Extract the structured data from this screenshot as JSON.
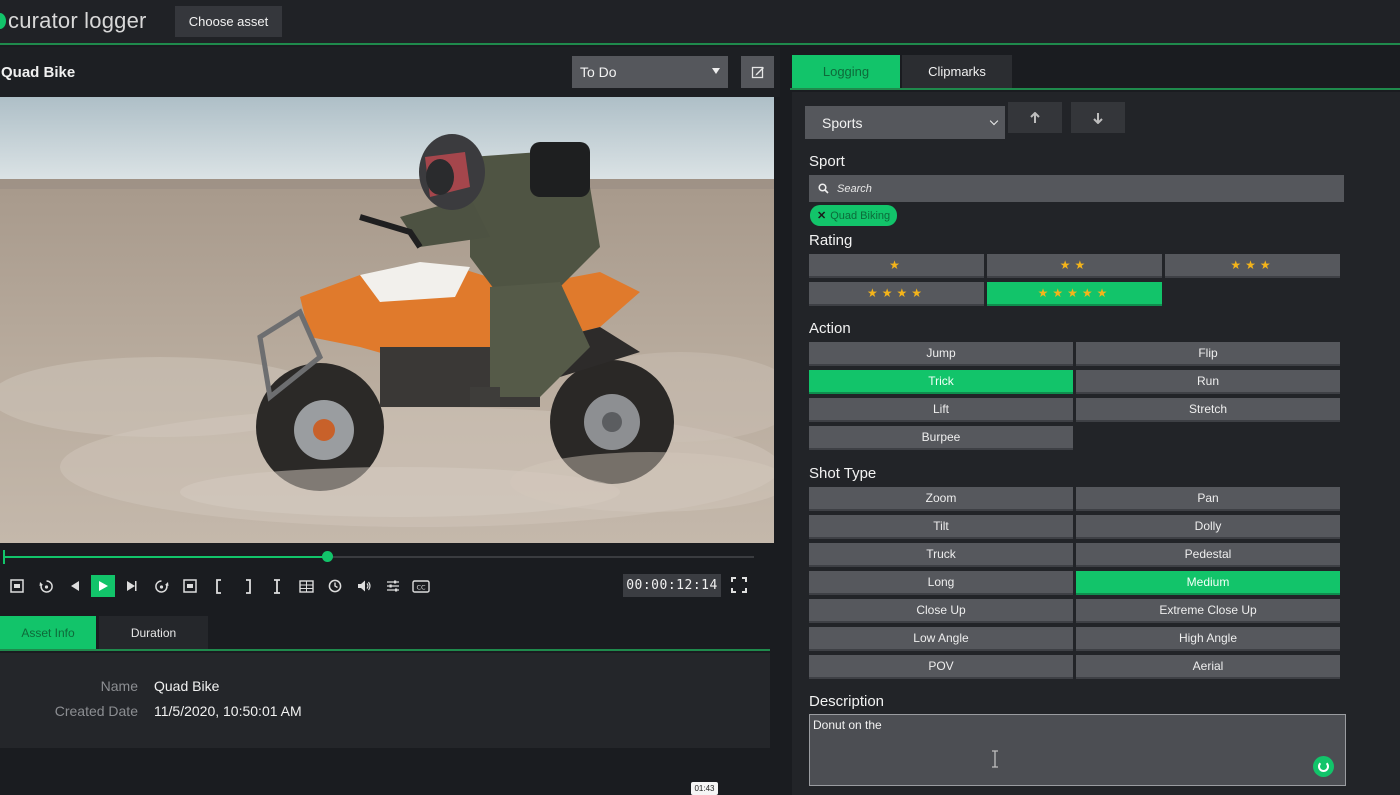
{
  "app": {
    "logo_text": "curator logger",
    "choose_asset_label": "Choose asset",
    "accent_color": "#12c46a",
    "background_color": "#1a1c20"
  },
  "asset": {
    "title": "Quad Bike",
    "status": "To Do",
    "status_options": [
      "To Do"
    ],
    "edit_icon": "edit-icon"
  },
  "player": {
    "timecode": "00:00:12:14",
    "progress": 0.43,
    "controls": [
      {
        "name": "go-to-start-icon",
        "glyph": "⊟"
      },
      {
        "name": "rewind-5s-icon",
        "glyph": "↺"
      },
      {
        "name": "step-back-icon",
        "glyph": "◀"
      },
      {
        "name": "play-icon",
        "glyph": "▶"
      },
      {
        "name": "step-forward-icon",
        "glyph": "▶"
      },
      {
        "name": "forward-5s-icon",
        "glyph": "↻"
      },
      {
        "name": "go-to-end-icon",
        "glyph": "⊟"
      },
      {
        "name": "mark-in-icon",
        "glyph": "["
      },
      {
        "name": "mark-out-icon",
        "glyph": "]"
      },
      {
        "name": "clip-range-icon",
        "glyph": "I"
      },
      {
        "name": "grid-icon",
        "glyph": "▦"
      },
      {
        "name": "clock-icon",
        "glyph": "◷"
      },
      {
        "name": "volume-icon",
        "glyph": "◀)"
      },
      {
        "name": "settings-sliders-icon",
        "glyph": "≡"
      },
      {
        "name": "captions-icon",
        "glyph": "CC"
      }
    ]
  },
  "info": {
    "tabs": [
      "Asset Info",
      "Duration"
    ],
    "fields": [
      {
        "label": "Name",
        "value": "Quad Bike"
      },
      {
        "label": "Created Date",
        "value": "11/5/2020, 10:50:01 AM"
      }
    ]
  },
  "right": {
    "tabs": [
      "Logging",
      "Clipmarks"
    ],
    "preset": "Sports",
    "sport": {
      "label": "Sport",
      "search_placeholder": "Search",
      "tags": [
        "Quad Biking"
      ]
    },
    "rating": {
      "label": "Rating",
      "options": [
        1,
        2,
        3,
        4,
        5
      ],
      "selected": 5
    },
    "action": {
      "label": "Action",
      "options": [
        "Jump",
        "Flip",
        "Trick",
        "Run",
        "Lift",
        "Stretch",
        "Burpee"
      ],
      "selected": "Trick"
    },
    "shot_type": {
      "label": "Shot Type",
      "options": [
        "Zoom",
        "Pan",
        "Tilt",
        "Dolly",
        "Truck",
        "Pedestal",
        "Long",
        "Medium",
        "Close Up",
        "Extreme Close Up",
        "Low Angle",
        "High Angle",
        "POV",
        "Aerial"
      ],
      "selected": "Medium"
    },
    "description": {
      "label": "Description",
      "value": "Donut on the"
    }
  },
  "overlay": {
    "badge": "01:43"
  }
}
